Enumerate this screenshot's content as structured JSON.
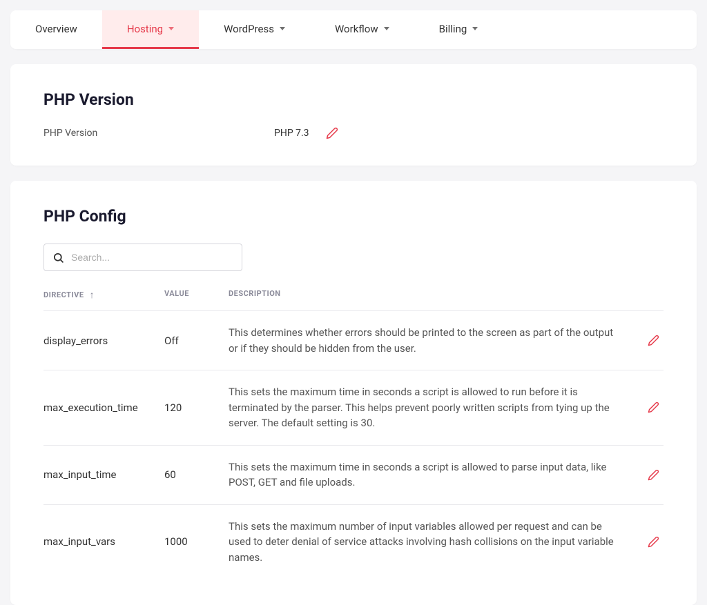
{
  "tabs": [
    {
      "label": "Overview",
      "has_dropdown": false,
      "active": false
    },
    {
      "label": "Hosting",
      "has_dropdown": true,
      "active": true
    },
    {
      "label": "WordPress",
      "has_dropdown": true,
      "active": false
    },
    {
      "label": "Workflow",
      "has_dropdown": true,
      "active": false
    },
    {
      "label": "Billing",
      "has_dropdown": true,
      "active": false
    }
  ],
  "php_version_panel": {
    "title": "PHP Version",
    "label": "PHP Version",
    "value": "PHP 7.3"
  },
  "php_config_panel": {
    "title": "PHP Config",
    "search_placeholder": "Search...",
    "columns": {
      "directive": "DIRECTIVE",
      "value": "VALUE",
      "description": "DESCRIPTION"
    },
    "rows": [
      {
        "directive": "display_errors",
        "value": "Off",
        "description": "This determines whether errors should be printed to the screen as part of the output or if they should be hidden from the user."
      },
      {
        "directive": "max_execution_time",
        "value": "120",
        "description": "This sets the maximum time in seconds a script is allowed to run before it is terminated by the parser. This helps prevent poorly written scripts from tying up the server. The default setting is 30."
      },
      {
        "directive": "max_input_time",
        "value": "60",
        "description": "This sets the maximum time in seconds a script is allowed to parse input data, like POST, GET and file uploads."
      },
      {
        "directive": "max_input_vars",
        "value": "1000",
        "description": "This sets the maximum number of input variables allowed per request and can be used to deter denial of service attacks involving hash collisions on the input variable names."
      }
    ]
  }
}
